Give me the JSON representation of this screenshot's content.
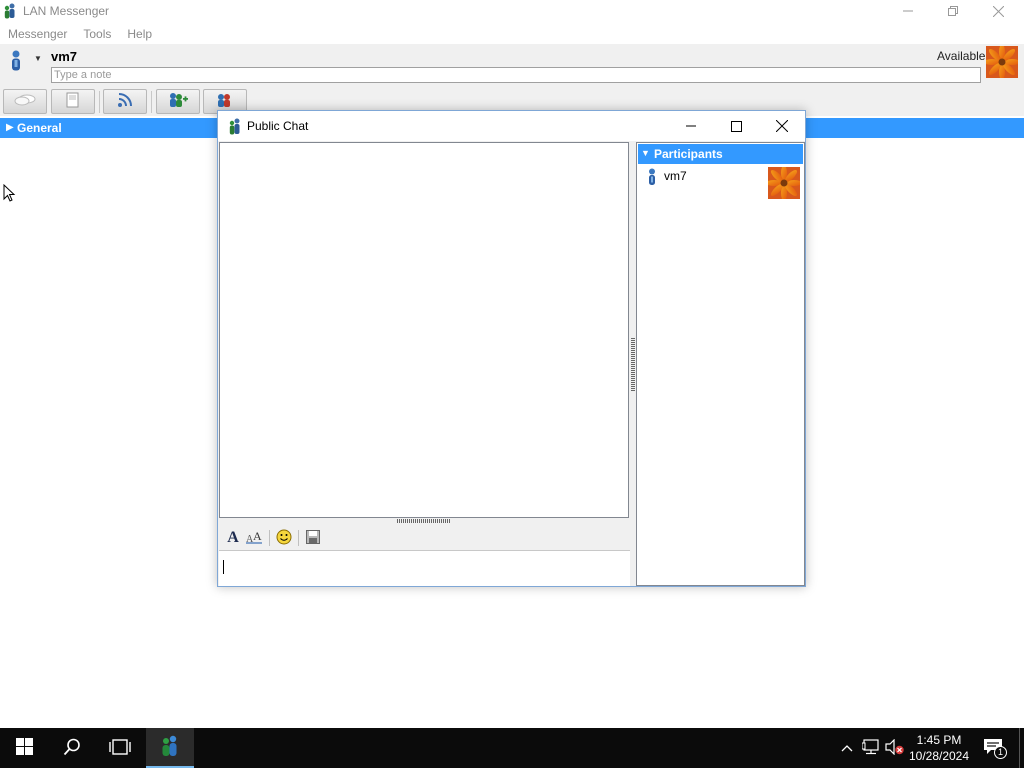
{
  "main_window": {
    "title": "LAN Messenger",
    "menu": [
      "Messenger",
      "Tools",
      "Help"
    ],
    "user_name": "vm7",
    "note_placeholder": "Type a note",
    "status": "Available",
    "toolbar": [
      "broadcast-icon",
      "transfers-icon",
      "history-icon",
      "add-contact-icon",
      "chat-room-icon"
    ],
    "groups": [
      {
        "label": "General",
        "expanded": false
      }
    ]
  },
  "chat_window": {
    "title": "Public Chat",
    "format_tools": [
      "font-icon",
      "font-color-icon",
      "smiley-icon",
      "save-icon"
    ],
    "message_value": "",
    "participants": {
      "header": "Participants",
      "items": [
        {
          "name": "vm7"
        }
      ]
    }
  },
  "taskbar": {
    "items": [
      "start-icon",
      "search-icon",
      "task-view-icon",
      "lan-messenger-icon"
    ],
    "time": "1:45 PM",
    "date": "10/28/2024",
    "notifications_count": "1"
  },
  "colors": {
    "accent": "#3399ff",
    "taskbar": "#0b0b0b",
    "chat_border": "#7fa7d6"
  }
}
